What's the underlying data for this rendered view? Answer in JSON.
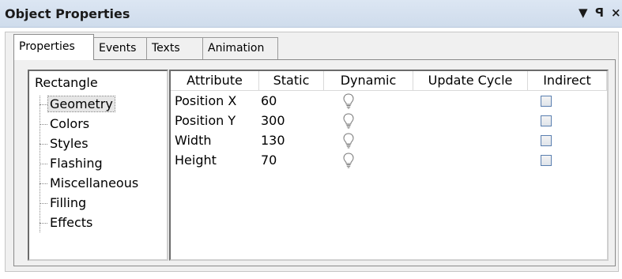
{
  "window": {
    "title": "Object Properties",
    "dropdown_glyph": "▼",
    "pin_glyph": "ꟼ",
    "close_glyph": "×"
  },
  "tabs": [
    {
      "label": "Properties",
      "active": true
    },
    {
      "label": "Events",
      "active": false
    },
    {
      "label": "Texts",
      "active": false
    },
    {
      "label": "Animation",
      "active": false
    }
  ],
  "tree": {
    "root": "Rectangle",
    "items": [
      {
        "label": "Geometry",
        "selected": true
      },
      {
        "label": "Colors"
      },
      {
        "label": "Styles"
      },
      {
        "label": "Flashing"
      },
      {
        "label": "Miscellaneous"
      },
      {
        "label": "Filling"
      },
      {
        "label": "Effects"
      }
    ]
  },
  "table": {
    "columns": [
      "Attribute",
      "Static",
      "Dynamic",
      "Update Cycle",
      "Indirect"
    ],
    "rows": [
      {
        "attribute": "Position X",
        "static": "60",
        "dynamic_icon": "lightbulb-icon",
        "update_cycle": "",
        "indirect": false
      },
      {
        "attribute": "Position Y",
        "static": "300",
        "dynamic_icon": "lightbulb-icon",
        "update_cycle": "",
        "indirect": false
      },
      {
        "attribute": "Width",
        "static": "130",
        "dynamic_icon": "lightbulb-icon",
        "update_cycle": "",
        "indirect": false
      },
      {
        "attribute": "Height",
        "static": "70",
        "dynamic_icon": "lightbulb-icon",
        "update_cycle": "",
        "indirect": false
      }
    ]
  }
}
